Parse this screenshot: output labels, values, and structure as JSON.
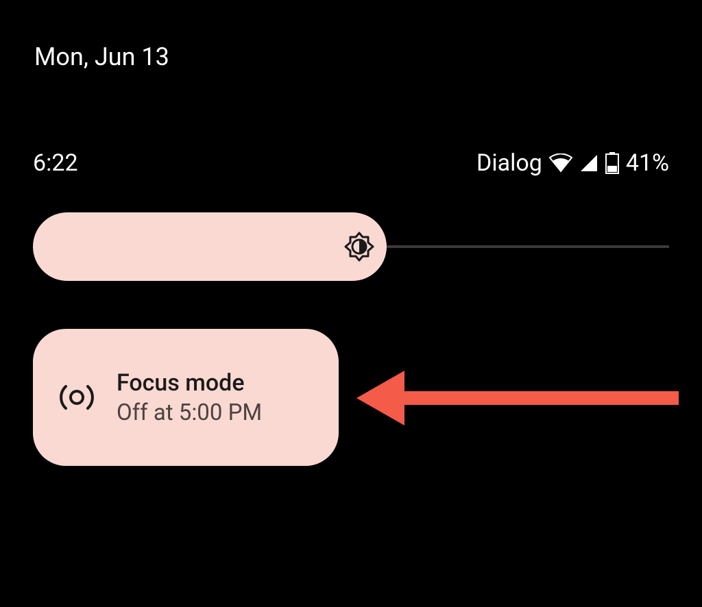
{
  "date_header": "Mon, Jun 13",
  "status": {
    "time": "6:22",
    "carrier": "Dialog",
    "battery_pct": "41%"
  },
  "brightness": {
    "level_pct": 55
  },
  "quick_tile": {
    "title": "Focus mode",
    "subtitle": "Off at 5:00 PM"
  },
  "colors": {
    "tile_bg": "#f9d9d2",
    "bg": "#000000",
    "arrow": "#f45b49"
  }
}
